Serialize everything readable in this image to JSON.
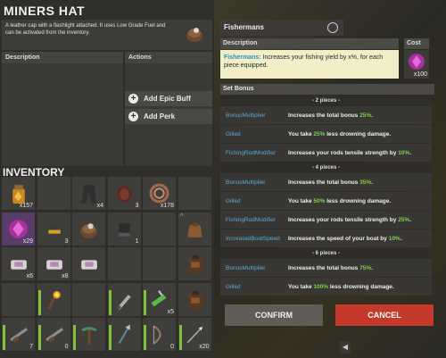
{
  "item": {
    "title": "MINERS HAT",
    "description": "A leather cap with a flashlight attached. It uses Low Grade Fuel and can be activated from the inventory.",
    "desc_header": "Description",
    "actions_header": "Actions",
    "add_epic_buff": "Add Epic Buff",
    "add_perk": "Add Perk"
  },
  "inventory": {
    "title": "INVENTORY",
    "slots": [
      {
        "icon": "fuel-jar-icon",
        "amount": "x157"
      },
      {
        "icon": "empty",
        "amount": ""
      },
      {
        "icon": "dark-pants-icon",
        "amount": "x4"
      },
      {
        "icon": "meat-icon",
        "amount": "3"
      },
      {
        "icon": "metal-spring-icon",
        "amount": "x178"
      },
      {
        "icon": "empty",
        "amount": ""
      },
      {
        "icon": "purple-crystal-icon",
        "amount": "x29",
        "selected": true
      },
      {
        "icon": "helmet-icon",
        "amount": "3"
      },
      {
        "icon": "miners-hat-icon",
        "amount": ""
      },
      {
        "icon": "gloves-icon",
        "amount": "1"
      },
      {
        "icon": "empty",
        "amount": ""
      },
      {
        "icon": "sack-icon",
        "amount": "",
        "upgrade": true
      },
      {
        "icon": "cloth-bundle-icon",
        "amount": "x6"
      },
      {
        "icon": "cloth-bundle-icon",
        "amount": "x8"
      },
      {
        "icon": "cloth-bundle-icon",
        "amount": ""
      },
      {
        "icon": "empty",
        "amount": ""
      },
      {
        "icon": "empty",
        "amount": ""
      },
      {
        "icon": "backpack-icon",
        "amount": ""
      },
      {
        "icon": "empty",
        "amount": ""
      },
      {
        "icon": "torch-icon",
        "amount": ""
      },
      {
        "icon": "empty",
        "amount": ""
      },
      {
        "icon": "knife-icon",
        "amount": ""
      },
      {
        "icon": "syringe-icon",
        "amount": "x5"
      },
      {
        "icon": "backpack-icon",
        "amount": ""
      },
      {
        "icon": "rifle-icon",
        "amount": "7"
      },
      {
        "icon": "rifle-icon",
        "amount": "0"
      },
      {
        "icon": "pickaxe-icon",
        "amount": ""
      },
      {
        "icon": "spear-icon",
        "amount": ""
      },
      {
        "icon": "bow-icon",
        "amount": "0"
      },
      {
        "icon": "arrow-icon",
        "amount": "x20"
      }
    ]
  },
  "set": {
    "name": "Fishermans",
    "desc_header": "Description",
    "cost_header": "Cost",
    "description_kw": "Fishermans:",
    "description_rest": " Increases your fishing yield by x%, for each piece equipped.",
    "cost_amount": "x100",
    "set_bonus_header": "Set Bonus",
    "tiers": [
      {
        "label": "- 2 pieces -",
        "rows": [
          {
            "key": "BonusMultiplier",
            "pre": "Increases the total bonus ",
            "val": "25%",
            "post": "."
          },
          {
            "key": "Gilled",
            "pre": "You take ",
            "val": "25%",
            "post": " less drowning damage."
          },
          {
            "key": "FishingRodModifier",
            "pre": "Increases your rods tensile strength by ",
            "val": "10%",
            "post": "."
          }
        ]
      },
      {
        "label": "- 4 pieces -",
        "rows": [
          {
            "key": "BonusMultiplier",
            "pre": "Increases the total bonus ",
            "val": "35%",
            "post": "."
          },
          {
            "key": "Gilled",
            "pre": "You take ",
            "val": "50%",
            "post": " less drowning damage."
          },
          {
            "key": "FishingRodModifier",
            "pre": "Increases your rods tensile strength by ",
            "val": "25%",
            "post": "."
          },
          {
            "key": "IncreasedBoatSpeed",
            "pre": "Increases the speed of your boat by ",
            "val": "10%",
            "post": "."
          }
        ]
      },
      {
        "label": "- 6 pieces -",
        "rows": [
          {
            "key": "BonusMultiplier",
            "pre": "Increases the total bonus ",
            "val": "75%",
            "post": "."
          },
          {
            "key": "Gilled",
            "pre": "You take ",
            "val": "100%",
            "post": " less drowning damage."
          }
        ]
      }
    ]
  },
  "buttons": {
    "confirm": "CONFIRM",
    "cancel": "CANCEL"
  },
  "colors": {
    "cancel": "#c4392c",
    "keyword": "#5aa8d6",
    "value": "#7ed14a"
  }
}
